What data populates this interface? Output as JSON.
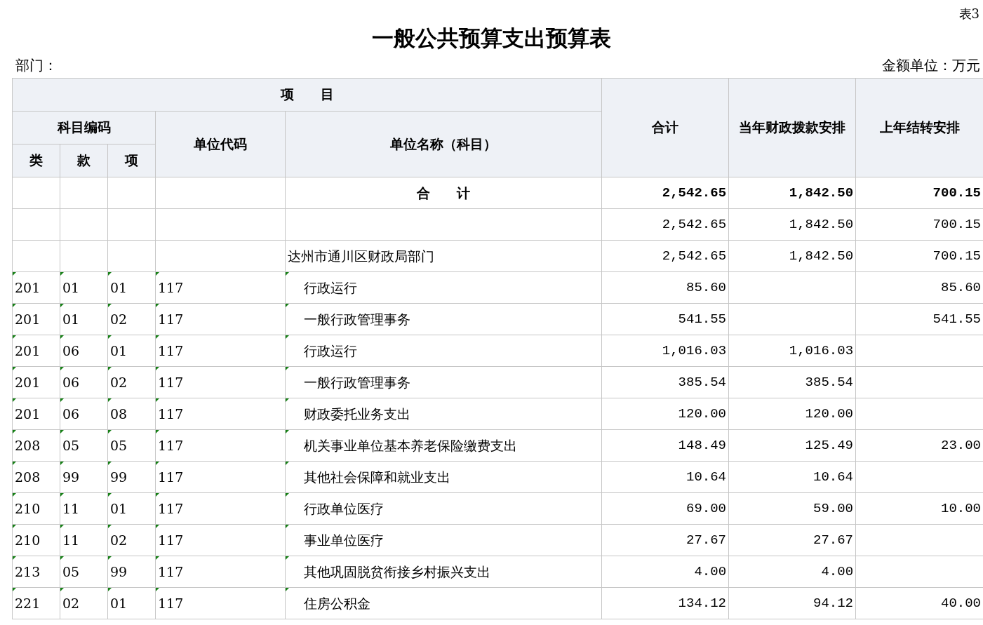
{
  "table_number": "表3",
  "title": "一般公共预算支出预算表",
  "department_label": "部门：",
  "unit_label": "金额单位：万元",
  "header": {
    "group": "项　　目",
    "code_group": "科目编码",
    "code_cols": [
      "类",
      "款",
      "项"
    ],
    "unit_code": "单位代码",
    "unit_name": "单位名称（科目）",
    "amount_cols": [
      "合计",
      "当年财政拨款安排",
      "上年结转安排"
    ]
  },
  "rows": [
    {
      "kind": "total",
      "flagged": false,
      "cells": [
        "",
        "",
        "",
        "",
        "合　　计",
        "2,542.65",
        "1,842.50",
        "700.15"
      ]
    },
    {
      "kind": "subtotal",
      "flagged": false,
      "cells": [
        "",
        "",
        "",
        "",
        "",
        "2,542.65",
        "1,842.50",
        "700.15"
      ]
    },
    {
      "kind": "unit",
      "flagged": false,
      "cells": [
        "",
        "",
        "",
        "",
        "达州市通川区财政局部门",
        "2,542.65",
        "1,842.50",
        "700.15"
      ]
    },
    {
      "kind": "item",
      "flagged": true,
      "cells": [
        "201",
        "01",
        "01",
        "117",
        "行政运行",
        "85.60",
        "",
        "85.60"
      ]
    },
    {
      "kind": "item",
      "flagged": true,
      "cells": [
        "201",
        "01",
        "02",
        "117",
        "一般行政管理事务",
        "541.55",
        "",
        "541.55"
      ]
    },
    {
      "kind": "item",
      "flagged": true,
      "cells": [
        "201",
        "06",
        "01",
        "117",
        "行政运行",
        "1,016.03",
        "1,016.03",
        ""
      ]
    },
    {
      "kind": "item",
      "flagged": true,
      "cells": [
        "201",
        "06",
        "02",
        "117",
        "一般行政管理事务",
        "385.54",
        "385.54",
        ""
      ]
    },
    {
      "kind": "item",
      "flagged": true,
      "cells": [
        "201",
        "06",
        "08",
        "117",
        "财政委托业务支出",
        "120.00",
        "120.00",
        ""
      ]
    },
    {
      "kind": "item",
      "flagged": true,
      "cells": [
        "208",
        "05",
        "05",
        "117",
        "机关事业单位基本养老保险缴费支出",
        "148.49",
        "125.49",
        "23.00"
      ]
    },
    {
      "kind": "item",
      "flagged": true,
      "cells": [
        "208",
        "99",
        "99",
        "117",
        "其他社会保障和就业支出",
        "10.64",
        "10.64",
        ""
      ]
    },
    {
      "kind": "item",
      "flagged": true,
      "cells": [
        "210",
        "11",
        "01",
        "117",
        "行政单位医疗",
        "69.00",
        "59.00",
        "10.00"
      ]
    },
    {
      "kind": "item",
      "flagged": true,
      "cells": [
        "210",
        "11",
        "02",
        "117",
        "事业单位医疗",
        "27.67",
        "27.67",
        ""
      ]
    },
    {
      "kind": "item",
      "flagged": true,
      "cells": [
        "213",
        "05",
        "99",
        "117",
        "其他巩固脱贫衔接乡村振兴支出",
        "4.00",
        "4.00",
        ""
      ]
    },
    {
      "kind": "item",
      "flagged": true,
      "cells": [
        "221",
        "02",
        "01",
        "117",
        "住房公积金",
        "134.12",
        "94.12",
        "40.00"
      ]
    }
  ]
}
